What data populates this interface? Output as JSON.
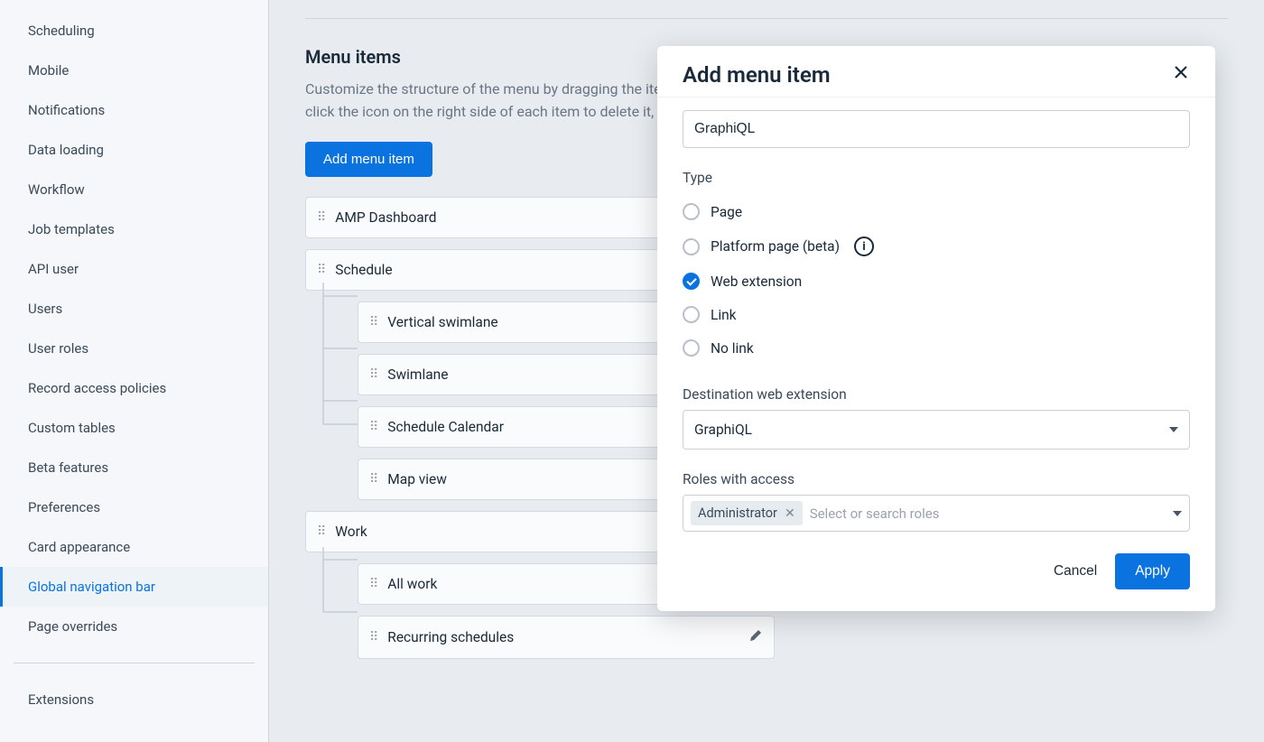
{
  "sidebar": {
    "items": [
      {
        "label": "Scheduling",
        "active": false
      },
      {
        "label": "Mobile",
        "active": false
      },
      {
        "label": "Notifications",
        "active": false
      },
      {
        "label": "Data loading",
        "active": false
      },
      {
        "label": "Workflow",
        "active": false
      },
      {
        "label": "Job templates",
        "active": false
      },
      {
        "label": "API user",
        "active": false
      },
      {
        "label": "Users",
        "active": false
      },
      {
        "label": "User roles",
        "active": false
      },
      {
        "label": "Record access policies",
        "active": false
      },
      {
        "label": "Custom tables",
        "active": false
      },
      {
        "label": "Beta features",
        "active": false
      },
      {
        "label": "Preferences",
        "active": false
      },
      {
        "label": "Card appearance",
        "active": false
      },
      {
        "label": "Global navigation bar",
        "active": true
      },
      {
        "label": "Page overrides",
        "active": false
      }
    ],
    "extensions_label": "Extensions"
  },
  "main": {
    "section_title": "Menu items",
    "section_desc": "Customize the structure of the menu by dragging the items into the position and nesting order you prefer. You can click the icon on the right side of each item to delete it, or click to reveal additional configuration options.",
    "add_button": "Add menu item",
    "items": [
      {
        "label": "AMP Dashboard",
        "level": 0
      },
      {
        "label": "Schedule",
        "level": 0
      },
      {
        "label": "Vertical swimlane",
        "level": 1
      },
      {
        "label": "Swimlane",
        "level": 1
      },
      {
        "label": "Schedule Calendar",
        "level": 1
      },
      {
        "label": "Map view",
        "level": 1
      },
      {
        "label": "Work",
        "level": 0
      },
      {
        "label": "All work",
        "level": 1
      },
      {
        "label": "Recurring schedules",
        "level": 1,
        "editable": true
      }
    ]
  },
  "modal": {
    "title": "Add menu item",
    "name_value": "GraphiQL",
    "type_label": "Type",
    "type_options": [
      {
        "label": "Page",
        "checked": false,
        "info": false
      },
      {
        "label": "Platform page (beta)",
        "checked": false,
        "info": true
      },
      {
        "label": "Web extension",
        "checked": true,
        "info": false
      },
      {
        "label": "Link",
        "checked": false,
        "info": false
      },
      {
        "label": "No link",
        "checked": false,
        "info": false
      }
    ],
    "dest_label": "Destination web extension",
    "dest_value": "GraphiQL",
    "roles_label": "Roles with access",
    "roles_chip": "Administrator",
    "roles_placeholder": "Select or search roles",
    "cancel": "Cancel",
    "apply": "Apply"
  }
}
